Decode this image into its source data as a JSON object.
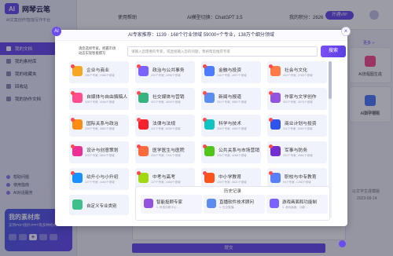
{
  "app": {
    "logo_mark": "AI",
    "name": "网琴云笔",
    "tagline": "AI文案创作/智能写作平台"
  },
  "sidebar": {
    "items": [
      {
        "label": "我的文档",
        "active": true
      },
      {
        "label": "我的素材库",
        "active": false
      },
      {
        "label": "我的收藏夹",
        "active": false
      },
      {
        "label": "回收站",
        "active": false
      },
      {
        "label": "我的协作文档",
        "active": false
      }
    ],
    "links": [
      "帮助问题",
      "使用指南",
      "AI对话服务"
    ],
    "library": {
      "title": "我的素材库",
      "subtitle": "支持PDF/图片/PPT等多种格式",
      "plus": "+"
    }
  },
  "topbar": {
    "help": "使用帮助",
    "model": "AI模型切换：ChatGPT 3.5",
    "points_label": "我的积分：2626",
    "upgrade": "开通VIP"
  },
  "right_panel": {
    "more": "更多 »",
    "card1": "AI流程图生成",
    "card2": "AI数字播报",
    "title": "立即编辑",
    "note": "以文字生成模版",
    "date": "2023-09-14"
  },
  "main": {
    "send": "提交"
  },
  "modal": {
    "badge": "AI",
    "title": "AI专家推荐：1139 · 168个行业领域 59000+个专业，138万个细分领域",
    "close": "×",
    "search_hint": "请您选择专家，把握市场动态实现智能撰写",
    "search_placeholder": "请输入您需要的专家，或直接输入您的问题，我将帮您推荐专家",
    "search_button": "搜索",
    "categories": [
      {
        "title": "企业与商业",
        "sub": "256个专家, 2466个领域",
        "color": "#f5a623"
      },
      {
        "title": "政治与公共事务",
        "sub": "233个专家, 4996个领域",
        "color": "#7b61ff"
      },
      {
        "title": "金融与投资",
        "sub": "246个专家, 4537个领域",
        "color": "#4d7cfe"
      },
      {
        "title": "社会与文化",
        "sub": "402个专家, 2765个领域",
        "color": "#ff7a45"
      },
      {
        "title": "自媒体与自由撰稿人",
        "sub": "326个专家, 4266个领域",
        "color": "#ff4d8d"
      },
      {
        "title": "社交媒体与营销",
        "sub": "301个专家, 4835个领域",
        "color": "#36b37e"
      },
      {
        "title": "新闻与报道",
        "sub": "351个专家, 3862个领域",
        "color": "#5b8def"
      },
      {
        "title": "作家与文学创作",
        "sub": "302个专家, 3576个领域",
        "color": "#9254de"
      },
      {
        "title": "国际关系与政治",
        "sub": "225个专家, 3862个领域",
        "color": "#fa8c16"
      },
      {
        "title": "法律与法规",
        "sub": "411个专家, 6235个领域",
        "color": "#f5222d"
      },
      {
        "title": "科学与技术",
        "sub": "326个专家, 4962个领域",
        "color": "#13c2c2"
      },
      {
        "title": "商业计划与投资",
        "sub": "311个专家, 3845个领域",
        "color": "#2f54eb"
      },
      {
        "title": "设计与创意策划",
        "sub": "325个专家, 3842个领域",
        "color": "#eb2f96"
      },
      {
        "title": "医学医生与医院",
        "sub": "205个专家, 7241个领域",
        "color": "#ff6a3d"
      },
      {
        "title": "公共关系与市场营销",
        "sub": "326个专家, 4268个领域",
        "color": "#52c41a"
      },
      {
        "title": "军事与防务",
        "sub": "202个专家, 2561个领域",
        "color": "#722ed1"
      },
      {
        "title": "幼升小与小升初",
        "sub": "127个专家, 4463个领域",
        "color": "#1890ff"
      },
      {
        "title": "中考与高考",
        "sub": "127个专家, 4466个领域",
        "color": "#a0d911"
      },
      {
        "title": "中小学教育",
        "sub": "120个专家, 4621个领域",
        "color": "#fa541c"
      },
      {
        "title": "职校与中专教育",
        "sub": "94个专家, 1266个领域",
        "color": "#597ef7"
      }
    ],
    "custom": {
      "title": "自定义专业类别"
    },
    "history": {
      "title": "历史记录",
      "items": [
        {
          "title": "智能投顾专家",
          "sub": "1. 科技创新中心 ...",
          "color": "#9254de"
        },
        {
          "title": "直播软件技术顾问",
          "sub": "1. 社交直播...",
          "color": "#5b8def"
        },
        {
          "title": "游戏画面和功能制",
          "sub": "3. 游戏画面、功能 ...",
          "color": "#7b61ff"
        }
      ]
    }
  }
}
